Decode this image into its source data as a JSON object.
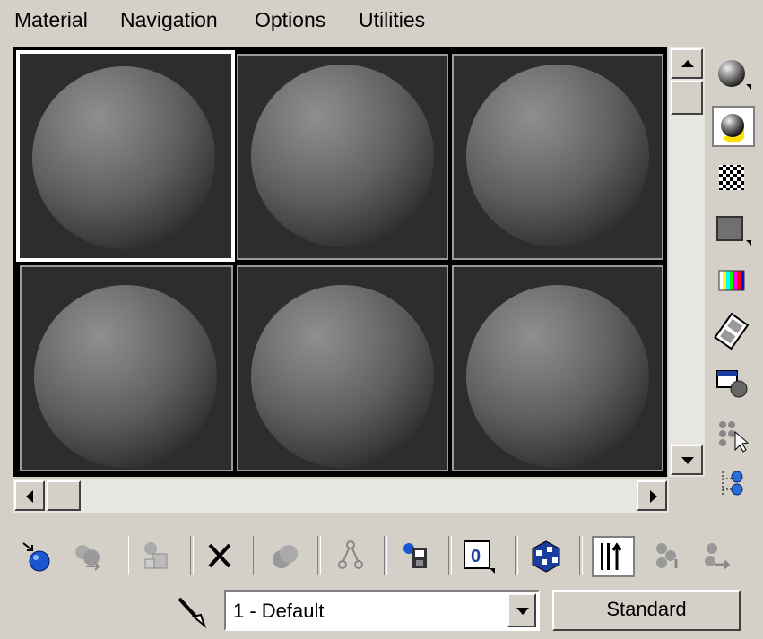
{
  "menu": [
    "Material",
    "Navigation",
    "Options",
    "Utilities"
  ],
  "slots": {
    "selected_index": 0,
    "count": 6
  },
  "side_icons": [
    "sample-type-sphere-icon",
    "backlight-icon",
    "background-checker-icon",
    "sample-uv-tiling-icon",
    "video-color-check-icon",
    "make-preview-icon",
    "options-icon",
    "select-by-material-icon",
    "material-map-navigator-icon"
  ],
  "toolbar_icons": [
    "get-material-icon",
    "put-material-to-scene-icon",
    "assign-material-to-selection-icon",
    "reset-map-icon",
    "make-material-copy-icon",
    "make-unique-icon",
    "put-to-library-icon",
    "material-effects-channel-icon",
    "show-map-in-viewport-icon",
    "show-end-result-icon",
    "go-to-parent-icon",
    "go-forward-to-sibling-icon"
  ],
  "material_name": "1 - Default",
  "material_type": "Standard"
}
